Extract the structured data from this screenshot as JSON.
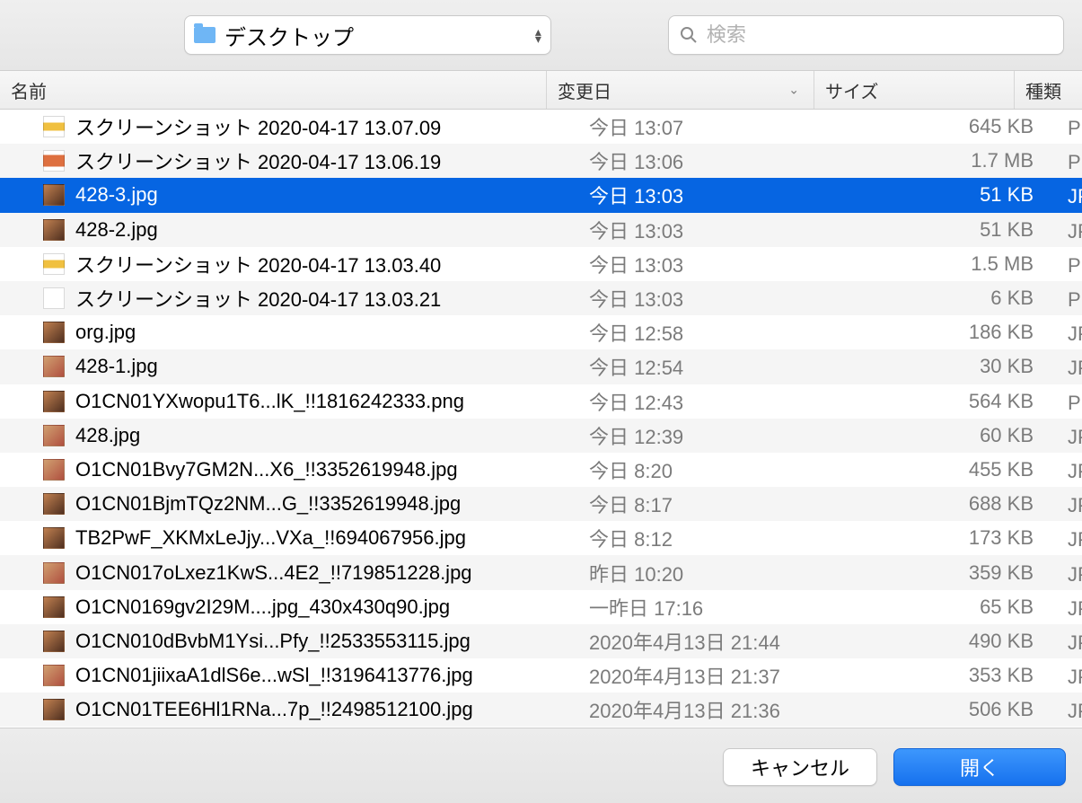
{
  "toolbar": {
    "location_label": "デスクトップ",
    "search_placeholder": "検索"
  },
  "columns": {
    "name": "名前",
    "modified": "変更日",
    "size": "サイズ",
    "kind": "種類"
  },
  "selected_index": 2,
  "files": [
    {
      "name": "スクリーンショット 2020-04-17 13.07.09",
      "modified": "今日 13:07",
      "size": "645 KB",
      "kind": "PNGイメ",
      "thumb": "bar1"
    },
    {
      "name": "スクリーンショット 2020-04-17 13.06.19",
      "modified": "今日 13:06",
      "size": "1.7 MB",
      "kind": "PNGイメ",
      "thumb": "bar2"
    },
    {
      "name": "428-3.jpg",
      "modified": "今日 13:03",
      "size": "51 KB",
      "kind": "JPEGイメ",
      "thumb": "photo"
    },
    {
      "name": "428-2.jpg",
      "modified": "今日 13:03",
      "size": "51 KB",
      "kind": "JPEGイメ",
      "thumb": "photo"
    },
    {
      "name": "スクリーンショット 2020-04-17 13.03.40",
      "modified": "今日 13:03",
      "size": "1.5 MB",
      "kind": "PNGイメ",
      "thumb": "bar1"
    },
    {
      "name": "スクリーンショット 2020-04-17 13.03.21",
      "modified": "今日 13:03",
      "size": "6 KB",
      "kind": "PNGイメ",
      "thumb": "white"
    },
    {
      "name": "org.jpg",
      "modified": "今日 12:58",
      "size": "186 KB",
      "kind": "JPEGイメ",
      "thumb": "photo"
    },
    {
      "name": "428-1.jpg",
      "modified": "今日 12:54",
      "size": "30 KB",
      "kind": "JPEGイメ",
      "thumb": "photo2"
    },
    {
      "name": "O1CN01YXwopu1T6...lK_!!1816242333.png",
      "modified": "今日 12:43",
      "size": "564 KB",
      "kind": "PNGイメ",
      "thumb": "photo"
    },
    {
      "name": "428.jpg",
      "modified": "今日 12:39",
      "size": "60 KB",
      "kind": "JPEGイメ",
      "thumb": "photo2"
    },
    {
      "name": "O1CN01Bvy7GM2N...X6_!!3352619948.jpg",
      "modified": "今日 8:20",
      "size": "455 KB",
      "kind": "JPEGイメ",
      "thumb": "photo2"
    },
    {
      "name": "O1CN01BjmTQz2NM...G_!!3352619948.jpg",
      "modified": "今日 8:17",
      "size": "688 KB",
      "kind": "JPEGイメ",
      "thumb": "photo"
    },
    {
      "name": "TB2PwF_XKMxLeJjy...VXa_!!694067956.jpg",
      "modified": "今日 8:12",
      "size": "173 KB",
      "kind": "JPEGイメ",
      "thumb": "photo"
    },
    {
      "name": "O1CN017oLxez1KwS...4E2_!!719851228.jpg",
      "modified": "昨日 10:20",
      "size": "359 KB",
      "kind": "JPEGイメ",
      "thumb": "photo2"
    },
    {
      "name": "O1CN0169gv2I29M....jpg_430x430q90.jpg",
      "modified": "一昨日 17:16",
      "size": "65 KB",
      "kind": "JPEGイメ",
      "thumb": "photo"
    },
    {
      "name": "O1CN010dBvbM1Ysi...Pfy_!!2533553115.jpg",
      "modified": "2020年4月13日 21:44",
      "size": "490 KB",
      "kind": "JPEGイメ",
      "thumb": "photo"
    },
    {
      "name": "O1CN01jiixaA1dlS6e...wSl_!!3196413776.jpg",
      "modified": "2020年4月13日 21:37",
      "size": "353 KB",
      "kind": "JPEGイメ",
      "thumb": "photo2"
    },
    {
      "name": "O1CN01TEE6Hl1RNa...7p_!!2498512100.jpg",
      "modified": "2020年4月13日 21:36",
      "size": "506 KB",
      "kind": "JPEGイメ",
      "thumb": "photo"
    }
  ],
  "buttons": {
    "cancel": "キャンセル",
    "open": "開く"
  }
}
